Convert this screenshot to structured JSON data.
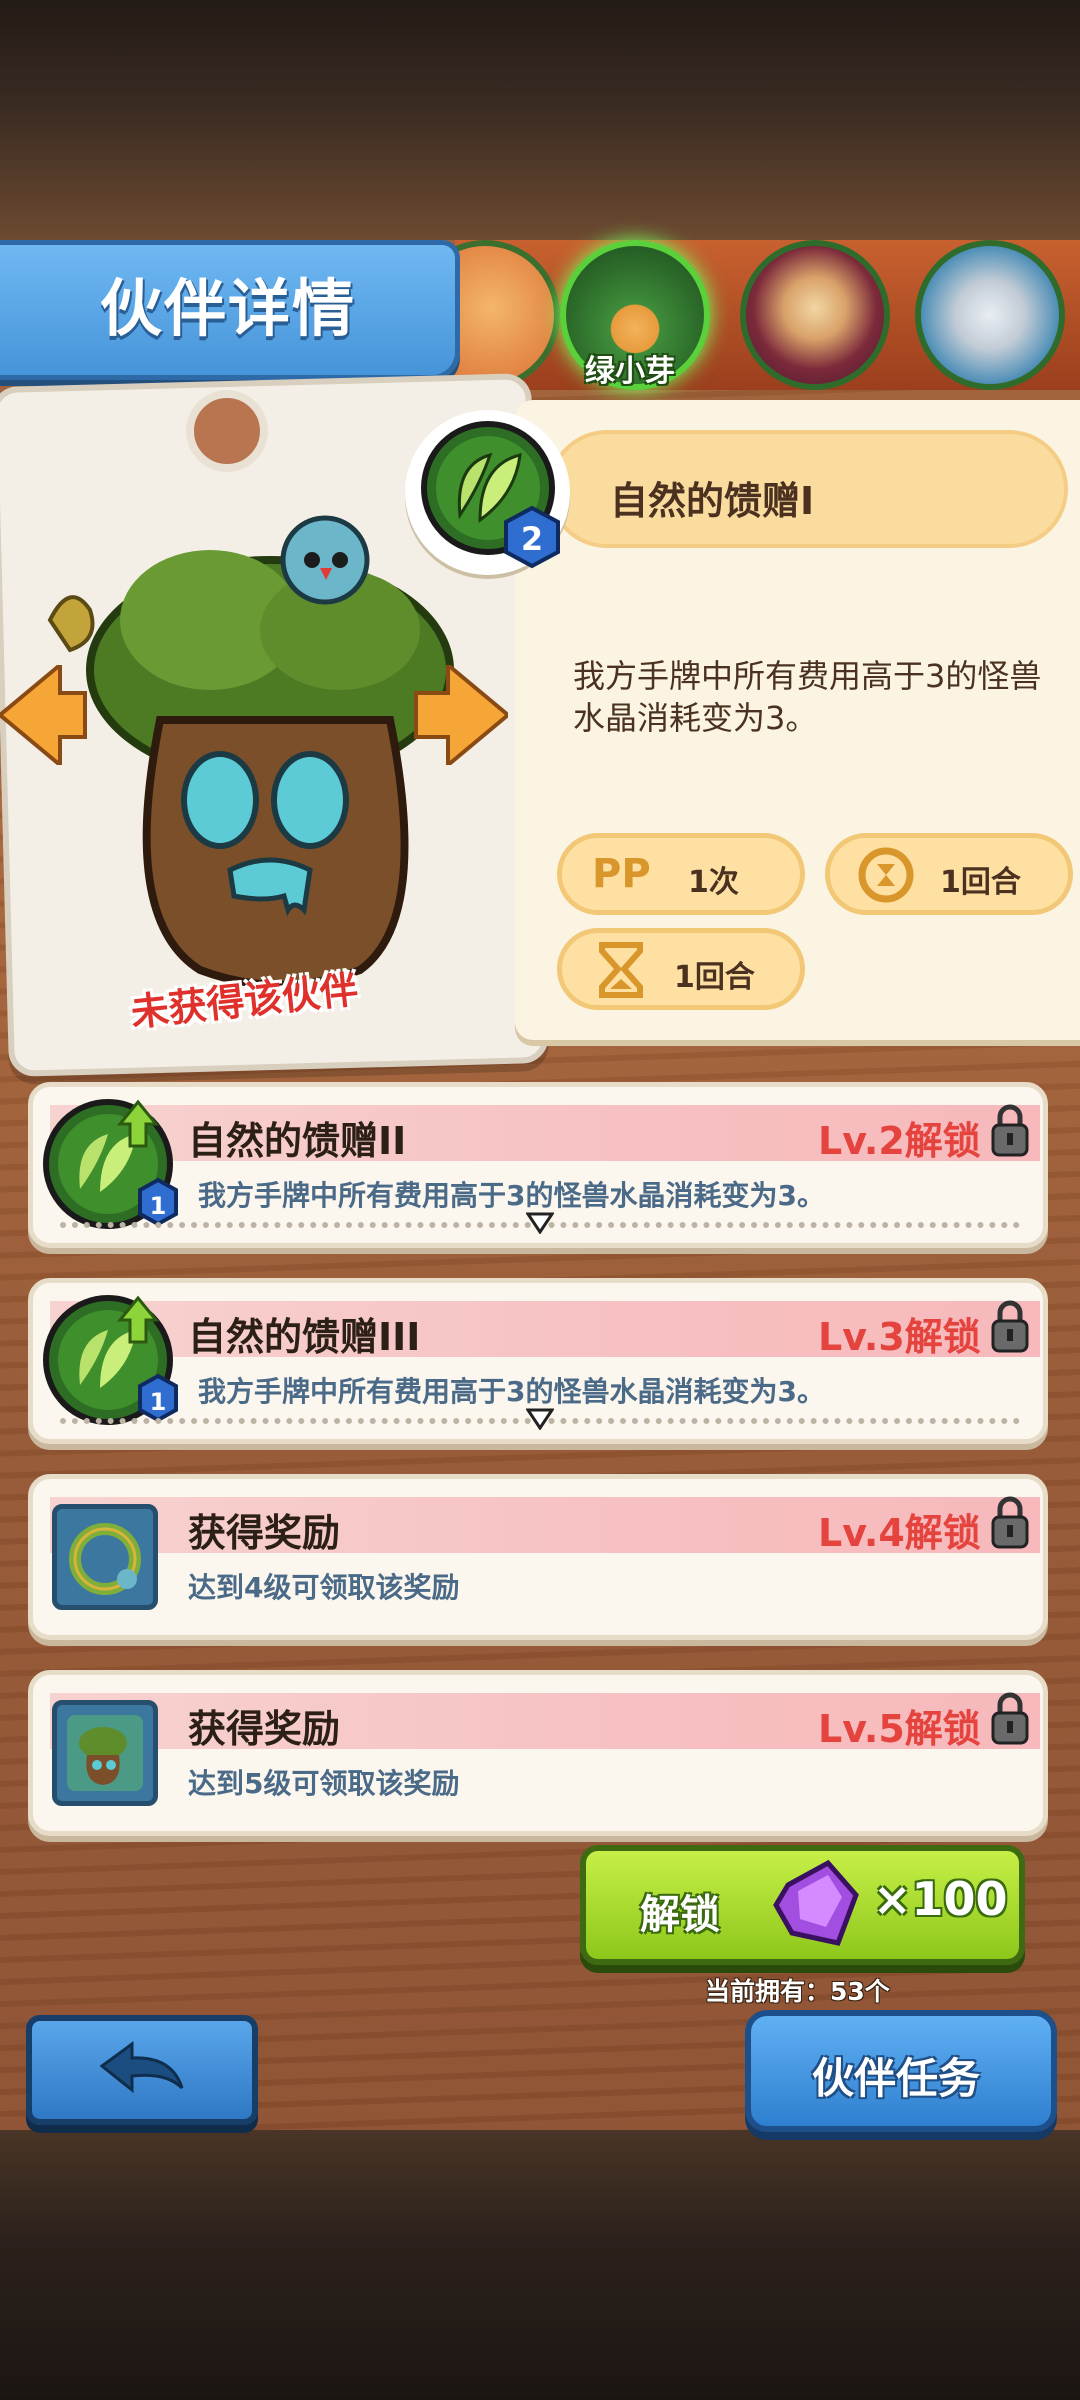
{
  "header": {
    "title": "伙伴详情"
  },
  "partner_strip": {
    "selected_name": "绿小芽",
    "partners": [
      "koi-partner",
      "green-sprout-partner",
      "owl-partner",
      "cat-partner"
    ]
  },
  "partner_card": {
    "status": "未获得该伙伴"
  },
  "skill": {
    "name": "自然的馈赠I",
    "cost": "2",
    "description": "我方手牌中所有费用高于3的怪兽水晶消耗变为3。",
    "stats": {
      "pp": "PP",
      "pp_value": "1次",
      "cooldown_value": "1回合",
      "duration_value": "1回合"
    }
  },
  "unlocks": [
    {
      "name": "自然的馈赠II",
      "level": "Lv.2解锁",
      "desc": "我方手牌中所有费用高于3的怪兽水晶消耗变为3。",
      "cost": "1"
    },
    {
      "name": "自然的馈赠III",
      "level": "Lv.3解锁",
      "desc": "我方手牌中所有费用高于3的怪兽水晶消耗变为3。",
      "cost": "1"
    },
    {
      "name": "获得奖励",
      "level": "Lv.4解锁",
      "desc": "达到4级可领取该奖励"
    },
    {
      "name": "获得奖励",
      "level": "Lv.5解锁",
      "desc": "达到5级可领取该奖励"
    }
  ],
  "unlock_button": {
    "label": "解锁",
    "cost": "×100"
  },
  "owned": "当前拥有：53个",
  "task_button": {
    "label": "伙伴任务"
  },
  "colors": {
    "accent_green": "#8ec71b",
    "accent_blue": "#2f7fd0",
    "locked_red": "#e4443d"
  }
}
